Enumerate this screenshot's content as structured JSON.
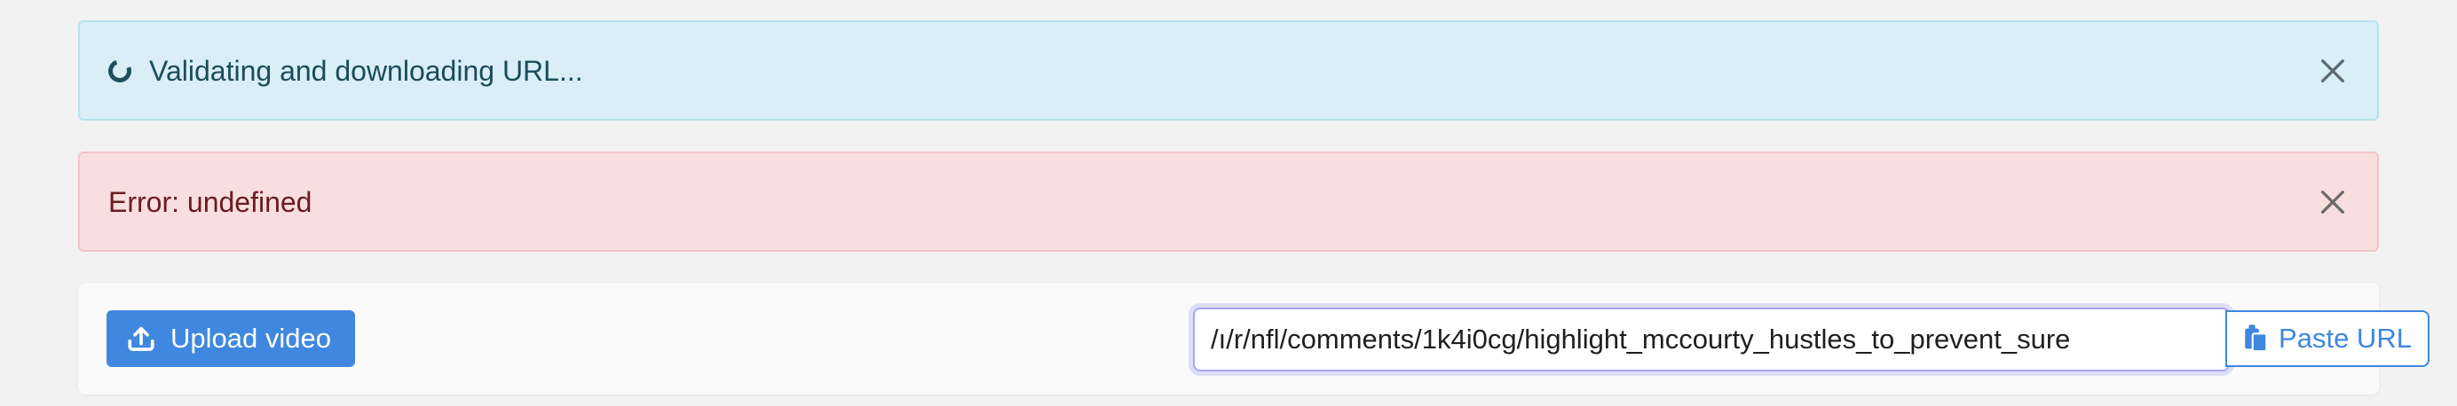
{
  "alerts": {
    "info": {
      "message": "Validating and downloading URL...",
      "spinner_icon": "spinner-icon",
      "close_icon": "close-icon",
      "colors": {
        "background": "#d9eef6",
        "border": "#b6e2ec",
        "text": "#1b4c5c"
      }
    },
    "error": {
      "message": "Error: undefined",
      "close_icon": "close-icon",
      "colors": {
        "background": "#f8dedf",
        "border": "#f2c4c7",
        "text": "#6e1a22"
      }
    }
  },
  "toolbar": {
    "upload_button": {
      "label": "Upload video",
      "icon": "upload-icon",
      "color": "#3f87df"
    },
    "url_input": {
      "value": "ı/r/nfl/comments/1k4i0cg/highlight_mccourty_hustles_to_prevent_sure/"
    },
    "paste_button": {
      "label": "Paste URL",
      "icon": "paste-icon",
      "color": "#3f87df"
    }
  }
}
